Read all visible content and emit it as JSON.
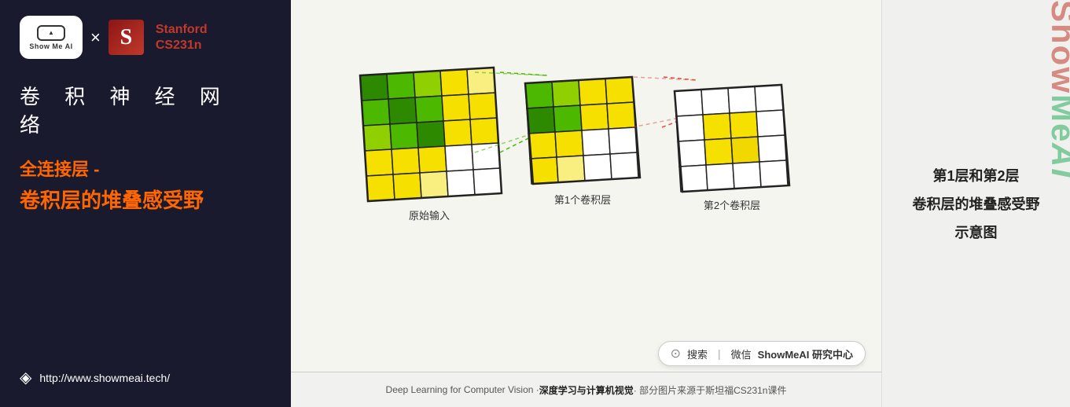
{
  "left": {
    "showmeai_label": "Show Me AI",
    "times": "×",
    "stanford_line1": "Stanford",
    "stanford_line2": "CS231n",
    "main_title": "卷 积 神 经 网 络",
    "sub_line1": "全连接层 -",
    "sub_line2": "卷积层的堆叠感受野",
    "url": "http://www.showmeai.tech/"
  },
  "diagram": {
    "layer1_label": "原始输入",
    "layer2_label": "第1个卷积层",
    "layer3_label": "第2个卷积层"
  },
  "right_panel": {
    "line1": "第1层和第2层",
    "line2": "卷积层的堆叠感受野",
    "line3": "示意图",
    "watermark": "ShowMeAI"
  },
  "bottom": {
    "text_plain": "Deep Learning for Computer Vision · ",
    "text_bold1": "深度学习与计算机视觉",
    "text_plain2": " · 部分图片来源于斯坦福CS231n课件"
  },
  "search": {
    "icon": "🔍",
    "label": "搜索",
    "divider": "|",
    "wechat_label": "微信",
    "brand": "ShowMeAI 研究中心"
  }
}
